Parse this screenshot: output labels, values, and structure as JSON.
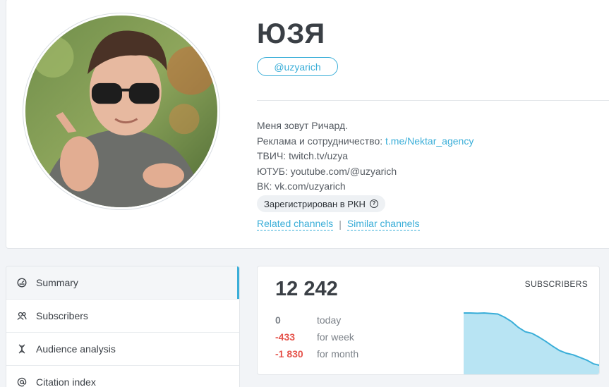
{
  "profile": {
    "name": "ЮЗЯ",
    "handle": "@uzyarich",
    "bio": {
      "line1": "Меня зовут Ричард.",
      "line2_prefix": "Реклама и сотрудничество: ",
      "line2_link": "t.me/Nektar_agency",
      "line3": "ТВИЧ: twitch.tv/uzya",
      "line4": "ЮТУБ: youtube.com/@uzyarich",
      "line5": "ВК: vk.com/uzyarich"
    },
    "rkn_badge": "Зарегистрирован в РКН",
    "related_channels": "Related channels",
    "separator": "|",
    "similar_channels": "Similar channels"
  },
  "nav": {
    "items": [
      {
        "label": "Summary",
        "icon": "dashboard-icon"
      },
      {
        "label": "Subscribers",
        "icon": "users-icon"
      },
      {
        "label": "Audience analysis",
        "icon": "dna-icon"
      },
      {
        "label": "Citation index",
        "icon": "at-icon"
      }
    ]
  },
  "stats": {
    "total": "12 242",
    "label": "SUBSCRIBERS",
    "rows": [
      {
        "value": "0",
        "text": "today",
        "tone": "neutral"
      },
      {
        "value": "-433",
        "text": "for week",
        "tone": "negative"
      },
      {
        "value": "-1 830",
        "text": "for month",
        "tone": "negative"
      }
    ],
    "sparkline": [
      1.0,
      1.0,
      0.995,
      1.0,
      0.99,
      0.98,
      0.92,
      0.84,
      0.73,
      0.65,
      0.62,
      0.55,
      0.47,
      0.38,
      0.3,
      0.25,
      0.22,
      0.17,
      0.12,
      0.05,
      0.02
    ],
    "colors": {
      "line": "#3aaed8",
      "fill": "#b8e4f3"
    }
  },
  "colors": {
    "accent": "#3aaed8",
    "negative": "#e5534b"
  }
}
